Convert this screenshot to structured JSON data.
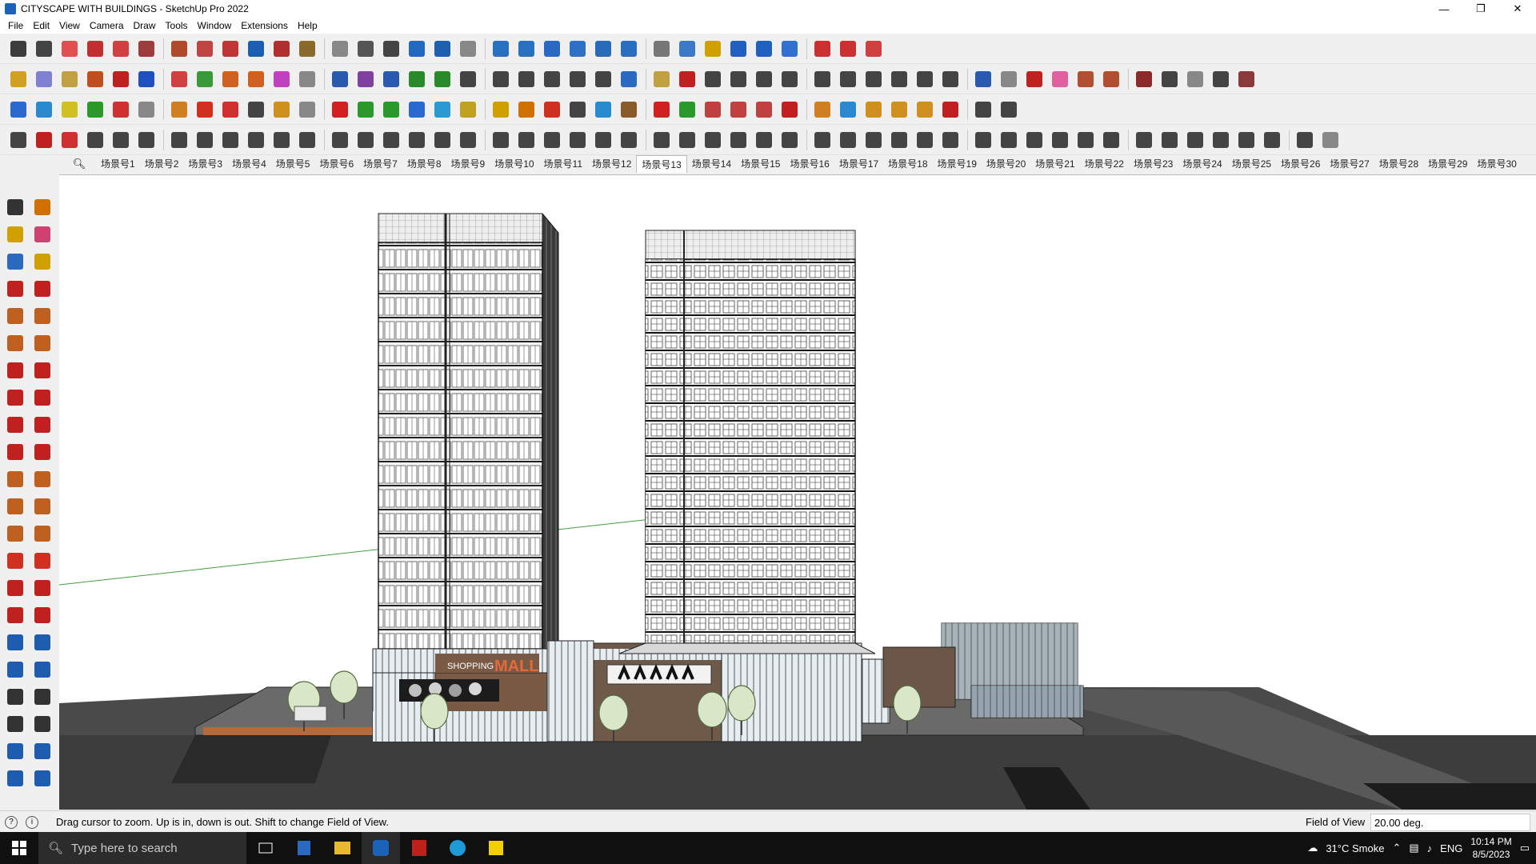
{
  "window": {
    "title": "CITYSCAPE WITH BUILDINGS - SketchUp Pro 2022",
    "controls": [
      "—",
      "❐",
      "✕"
    ]
  },
  "menu": [
    "File",
    "Edit",
    "View",
    "Camera",
    "Draw",
    "Tools",
    "Window",
    "Extensions",
    "Help"
  ],
  "toolbar_rows": [
    {
      "name": "standard-tools",
      "colors": [
        "#3c3c3c",
        "#444",
        "#e05050",
        "#c03030",
        "#d04040",
        "#9c3c3c",
        "#b04a2a",
        "#c04444",
        "#c03636",
        "#1a5fb4",
        "#b03030",
        "#8a6a2a",
        "#888",
        "#555",
        "#444",
        "#2268c0",
        "#1e60b0",
        "#888",
        "#2a70c0",
        "#2a70c0",
        "#2a6ac4",
        "#2c70c8",
        "#286bb8",
        "#2a6ec0",
        "#777",
        "#3a7ac8",
        "#d0a000",
        "#2060c0",
        "#2060c0",
        "#3070d0",
        "#cc3030",
        "#cc3030",
        "#d04040"
      ]
    },
    {
      "name": "solid-tools",
      "colors": [
        "#d0a020",
        "#8080d0",
        "#c0a040",
        "#c05020",
        "#c02020",
        "#2050c0",
        "#d04040",
        "#3a9a3a",
        "#d06020",
        "#d06020",
        "#c040c0",
        "#888",
        "#2a5ab0",
        "#8040a0",
        "#2a5ab0",
        "#2a8a2a",
        "#2a8a2a",
        "#444",
        "#444",
        "#444",
        "#444",
        "#444",
        "#444",
        "#2a6ac0",
        "#c0a040",
        "#c02020",
        "#444",
        "#444",
        "#444",
        "#444",
        "#444",
        "#444",
        "#444",
        "#444",
        "#444",
        "#444",
        "#2a5ab0",
        "#888",
        "#c02020",
        "#e060a0",
        "#b05030",
        "#b05030",
        "#8a2a2a",
        "#444",
        "#888",
        "#444",
        "#8a3a3a"
      ]
    },
    {
      "name": "extensions-1",
      "colors": [
        "#2a6ad0",
        "#2a8ad0",
        "#d0c020",
        "#2a9a2a",
        "#d03030",
        "#888",
        "#d08020",
        "#d03020",
        "#d03030",
        "#444",
        "#d09020",
        "#888",
        "#d02020",
        "#2a9a2a",
        "#2a9a2a",
        "#2a6ad0",
        "#2a9ad0",
        "#c0a020",
        "#d0a000",
        "#d07000",
        "#d03020",
        "#444",
        "#2a8ad0",
        "#8a5a2a",
        "#d02020",
        "#2a9a2a",
        "#c04040",
        "#c04040",
        "#c04040",
        "#c02020",
        "#d08020",
        "#2a8ad0",
        "#d09020",
        "#d09020",
        "#d09020",
        "#c02020",
        "#444",
        "#444"
      ]
    },
    {
      "name": "extensions-2",
      "colors": [
        "#444",
        "#c02020",
        "#d03030",
        "#444",
        "#444",
        "#444",
        "#444",
        "#444",
        "#444",
        "#444",
        "#444",
        "#444",
        "#444",
        "#444",
        "#444",
        "#444",
        "#444",
        "#444",
        "#444",
        "#444",
        "#444",
        "#444",
        "#444",
        "#444",
        "#444",
        "#444",
        "#444",
        "#444",
        "#444",
        "#444",
        "#444",
        "#444",
        "#444",
        "#444",
        "#444",
        "#444",
        "#444",
        "#444",
        "#444",
        "#444",
        "#444",
        "#444",
        "#444",
        "#444",
        "#444",
        "#444",
        "#444",
        "#444",
        "#444",
        "#888"
      ]
    }
  ],
  "scenes": {
    "tabs": [
      "场景号1",
      "场景号2",
      "场景号3",
      "场景号4",
      "场景号5",
      "场景号6",
      "场景号7",
      "场景号8",
      "场景号9",
      "场景号10",
      "场景号11",
      "场景号12",
      "场景号13",
      "场景号14",
      "场景号15",
      "场景号16",
      "场景号17",
      "场景号18",
      "场景号19",
      "场景号20",
      "场景号21",
      "场景号22",
      "场景号23",
      "场景号24",
      "场景号25",
      "场景号26",
      "场景号27",
      "场景号28",
      "场景号29",
      "场景号30"
    ],
    "active_index": 12
  },
  "left_tools": {
    "colors": [
      "#333",
      "#d07000",
      "#d0a000",
      "#d04070",
      "#2a6ac0",
      "#d0a000",
      "#c02020",
      "#c02020",
      "#c06020",
      "#c06020",
      "#c06020",
      "#c06020",
      "#c02020",
      "#c02020",
      "#c02020",
      "#c02020",
      "#c02020",
      "#c02020",
      "#c02020",
      "#c02020",
      "#c06020",
      "#c06020",
      "#c06020",
      "#c06020",
      "#c06020",
      "#c06020",
      "#d03020",
      "#d03020",
      "#c02020",
      "#c02020",
      "#c02020",
      "#c02020",
      "#1e5cb0",
      "#1e5cb0",
      "#1e5cb0",
      "#1e5cb0",
      "#333",
      "#333",
      "#333",
      "#333",
      "#1e5cb0",
      "#1e5cb0",
      "#1e5cb0",
      "#1e5cb0"
    ]
  },
  "signage": {
    "mall_small": "SHOPPING",
    "mall_big": "MALL"
  },
  "status": {
    "message": "Drag cursor to zoom.  Up is in, down is out. Shift to change Field of View.",
    "vcb_label": "Field of View",
    "vcb_value": "20.00 deg."
  },
  "taskbar": {
    "search_placeholder": "Type here to search",
    "weather": "31°C  Smoke",
    "language": "ENG",
    "time": "10:14 PM",
    "date": "8/5/2023"
  }
}
